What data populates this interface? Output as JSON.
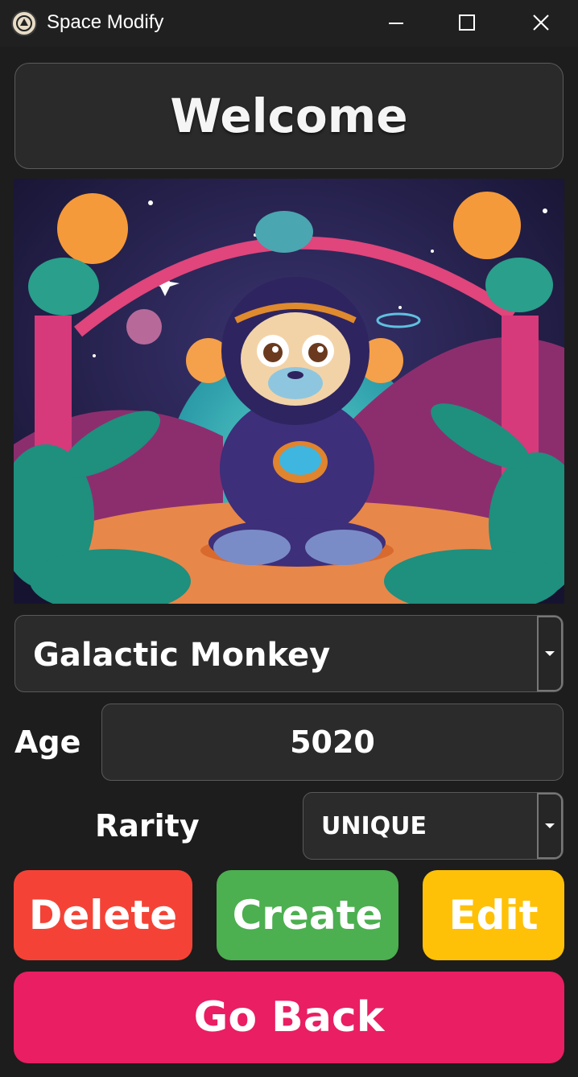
{
  "window": {
    "title": "Space Modify",
    "icon": "app-logo-icon",
    "controls": [
      "minimize-icon",
      "maximize-icon",
      "close-icon"
    ]
  },
  "header": {
    "welcome": "Welcome"
  },
  "image": {
    "subject": "monkey-astronaut-illustration"
  },
  "form": {
    "name_value": "Galactic Monkey",
    "age_label": "Age",
    "age_value": "5020",
    "rarity_label": "Rarity",
    "rarity_value": "UNIQUE"
  },
  "actions": {
    "delete": "Delete",
    "create": "Create",
    "edit": "Edit",
    "back": "Go Back"
  },
  "colors": {
    "delete": "#f44336",
    "create": "#4caf50",
    "edit": "#ffc107",
    "back": "#e91e63",
    "background": "#1d1d1d"
  }
}
